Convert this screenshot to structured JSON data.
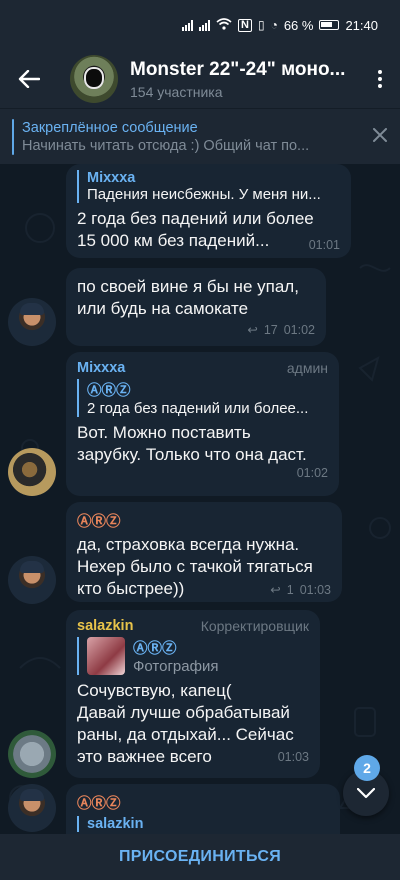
{
  "status_bar": {
    "battery": "66 %",
    "time": "21:40"
  },
  "header": {
    "title": "Monster 22\"-24\" моно...",
    "subtitle": "154 участника"
  },
  "pinned": {
    "title": "Закреплённое сообщение",
    "text": "Начинать читать отсюда :) Общий чат по..."
  },
  "messages": [
    {
      "reply_name": "Mixxxa",
      "reply_text": "Падения неисбежны. У меня ни...",
      "text": "2 года без падений или более\n15 000 км без падений...",
      "time": "01:01"
    },
    {
      "text": "по своей вине я бы не упал,\nили будь на самокате",
      "replies": "17",
      "time": "01:02"
    },
    {
      "sender": "Mixxxa",
      "role": "админ",
      "reply_name": "ⒶⓇⓏ",
      "reply_text": "2 года без падений или более...",
      "text": "Вот. Можно поставить\nзарубку. Только что она даст.",
      "time": "01:02"
    },
    {
      "sender": "ⒶⓇⓏ",
      "text": "да, страховка всегда нужна.\nНехер было с тачкой тягаться\nкто быстрее))",
      "replies": "1",
      "time": "01:03"
    },
    {
      "sender": "salazkin",
      "role": "Корректировщик",
      "reply_name": "ⒶⓇⓏ",
      "reply_text": "Фотография",
      "text": "Сочувствую, капец(\nДавай лучше обрабатывай\nраны, да отдыхай... Сейчас\nэто важнее всего",
      "time": "01:03"
    },
    {
      "sender": "ⒶⓇⓏ",
      "reply_name": "salazkin",
      "text": ""
    }
  ],
  "unread_count": "2",
  "join_label": "ПРИСОЕДИНИТЬСЯ",
  "colors": {
    "accent": "#6ab2f2",
    "bubble": "#182533",
    "header": "#1d2733",
    "sender_azr": "#e8855b",
    "sender_salazkin": "#e8c34a",
    "sender_mixxxa": "#6ab2f2"
  }
}
